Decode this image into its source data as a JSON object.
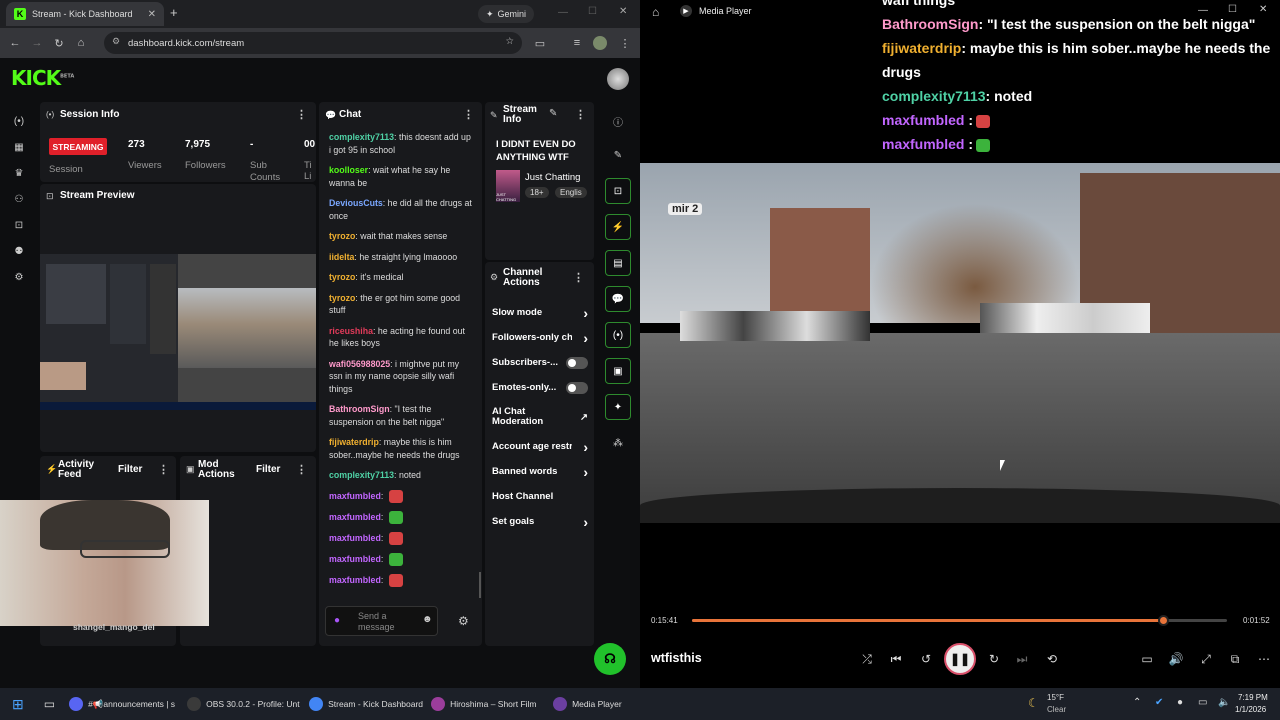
{
  "browser": {
    "tab_title": "Stream - Kick Dashboard",
    "gemini_label": "Gemini",
    "url": "dashboard.kick.com/stream"
  },
  "kick": {
    "logo": "KICK",
    "logo_badge": "BETA",
    "session_info": {
      "title": "Session Info",
      "status": "STREAMING",
      "status_label": "Session",
      "stats": [
        {
          "value": "273",
          "label": "Viewers"
        },
        {
          "value": "7,975",
          "label": "Followers"
        },
        {
          "value": "-",
          "label": "Sub Counts"
        },
        {
          "value": "00",
          "label": "Ti Li"
        }
      ]
    },
    "stream_preview": {
      "title": "Stream Preview"
    },
    "activity_feed": {
      "title": "Activity Feed",
      "filter": "Filter"
    },
    "mod_actions": {
      "title": "Mod Actions",
      "filter": "Filter"
    },
    "webcam_name": "shangel_mango_del",
    "chat": {
      "title": "Chat",
      "placeholder": "Send a message",
      "messages": [
        {
          "user": "complexity7113",
          "text": "this doesnt add up i got 95 in school",
          "color": "#4fd1a5"
        },
        {
          "user": "koolloser",
          "text": "wait what he say he wanna be",
          "color": "#53fc18"
        },
        {
          "user": "DeviousCuts",
          "text": "he did all the drugs at once",
          "color": "#7aa7ff"
        },
        {
          "user": "tyrozo",
          "text": "wait that makes sense",
          "color": "#f0b030"
        },
        {
          "user": "iidelta",
          "text": "he straight lying lmaoooo",
          "color": "#f0b030"
        },
        {
          "user": "tyrozo",
          "text": "it's medical",
          "color": "#f0b030"
        },
        {
          "user": "tyrozo",
          "text": "the er got him some good stuff",
          "color": "#f0b030"
        },
        {
          "user": "riceushiha",
          "text": "he acting he found out he likes boys",
          "color": "#e23b5a"
        },
        {
          "user": "wafi056988025",
          "text": "i mightve put my ssn in my name oopsie silly wafi things",
          "color": "#ff9acb"
        },
        {
          "user": "BathroomSign",
          "text": "\"I test the suspension on the belt nigga\"",
          "color": "#ff9acb"
        },
        {
          "user": "fijiwaterdrip",
          "text": "maybe this is him sober..maybe he needs the drugs",
          "color": "#f0b030"
        },
        {
          "user": "complexity7113",
          "text": "noted",
          "color": "#4fd1a5"
        },
        {
          "user": "maxfumbled",
          "text": "",
          "color": "#c266ff",
          "emote": "#d64242"
        },
        {
          "user": "maxfumbled",
          "text": "",
          "color": "#c266ff",
          "emote": "#3cb33c"
        },
        {
          "user": "maxfumbled",
          "text": "",
          "color": "#c266ff",
          "emote": "#d64242"
        },
        {
          "user": "maxfumbled",
          "text": "",
          "color": "#c266ff",
          "emote": "#3cb33c"
        },
        {
          "user": "maxfumbled",
          "text": "",
          "color": "#c266ff",
          "emote": "#d64242"
        }
      ]
    },
    "stream_info": {
      "title": "Stream Info",
      "stream_title": "I DIDNT EVEN DO ANYTHING WTF",
      "category": "Just Chatting",
      "tags": [
        "18+",
        "Englis"
      ],
      "boxart": "JUST CHATTING"
    },
    "channel_actions": {
      "title": "Channel Actions",
      "items": [
        {
          "label": "Slow mode",
          "kind": "chevron"
        },
        {
          "label": "Followers-only ch",
          "kind": "chevron"
        },
        {
          "label": "Subscribers-...",
          "kind": "toggle"
        },
        {
          "label": "Emotes-only...",
          "kind": "toggle"
        },
        {
          "label": "AI Chat Moderation",
          "kind": "link"
        },
        {
          "label": "Account age restr",
          "kind": "chevron"
        },
        {
          "label": "Banned words",
          "kind": "chevron"
        },
        {
          "label": "Host Channel",
          "kind": "none"
        },
        {
          "label": "Set goals",
          "kind": "chevron"
        }
      ]
    }
  },
  "player": {
    "title": "Media Player",
    "chat_overlay": [
      {
        "user": "",
        "text": "wafi things",
        "color": "#ffffff"
      },
      {
        "user": "BathroomSign",
        "text": ": \"I test the suspension on the belt nigga\"",
        "color": "#ff9acb"
      },
      {
        "user": "fijiwaterdrip",
        "text": ": maybe this is him sober..maybe he needs the drugs",
        "color": "#f0b030"
      },
      {
        "user": "complexity7113",
        "text": ": noted",
        "color": "#4fd1a5"
      },
      {
        "user": "maxfumbled",
        "text": " :",
        "color": "#c266ff",
        "emote": "#d64242"
      },
      {
        "user": "maxfumbled",
        "text": " :",
        "color": "#c266ff",
        "emote": "#3cb33c"
      },
      {
        "user": "maxfumbled",
        "text": " :",
        "color": "#c266ff",
        "emote": "#d64242"
      }
    ],
    "watermark": "mir 2",
    "elapsed": "0:15:41",
    "remaining": "0:01:52",
    "progress": 0.88,
    "now_playing": "wtfisthis"
  },
  "taskbar": {
    "items": [
      {
        "label": "#📢announcements | s",
        "color": "#5865f2"
      },
      {
        "label": "OBS 30.0.2 - Profile: Unt",
        "color": "#3a3a3a"
      },
      {
        "label": "Stream - Kick Dashboard",
        "color": "#4285f4"
      },
      {
        "label": "Hiroshima – Short Film",
        "color": "#9b3d9b"
      },
      {
        "label": "Media Player",
        "color": "#6b3fa0"
      }
    ],
    "weather_temp": "15°F",
    "weather_desc": "Clear",
    "time": "7:19 PM",
    "date": "1/1/2026"
  }
}
